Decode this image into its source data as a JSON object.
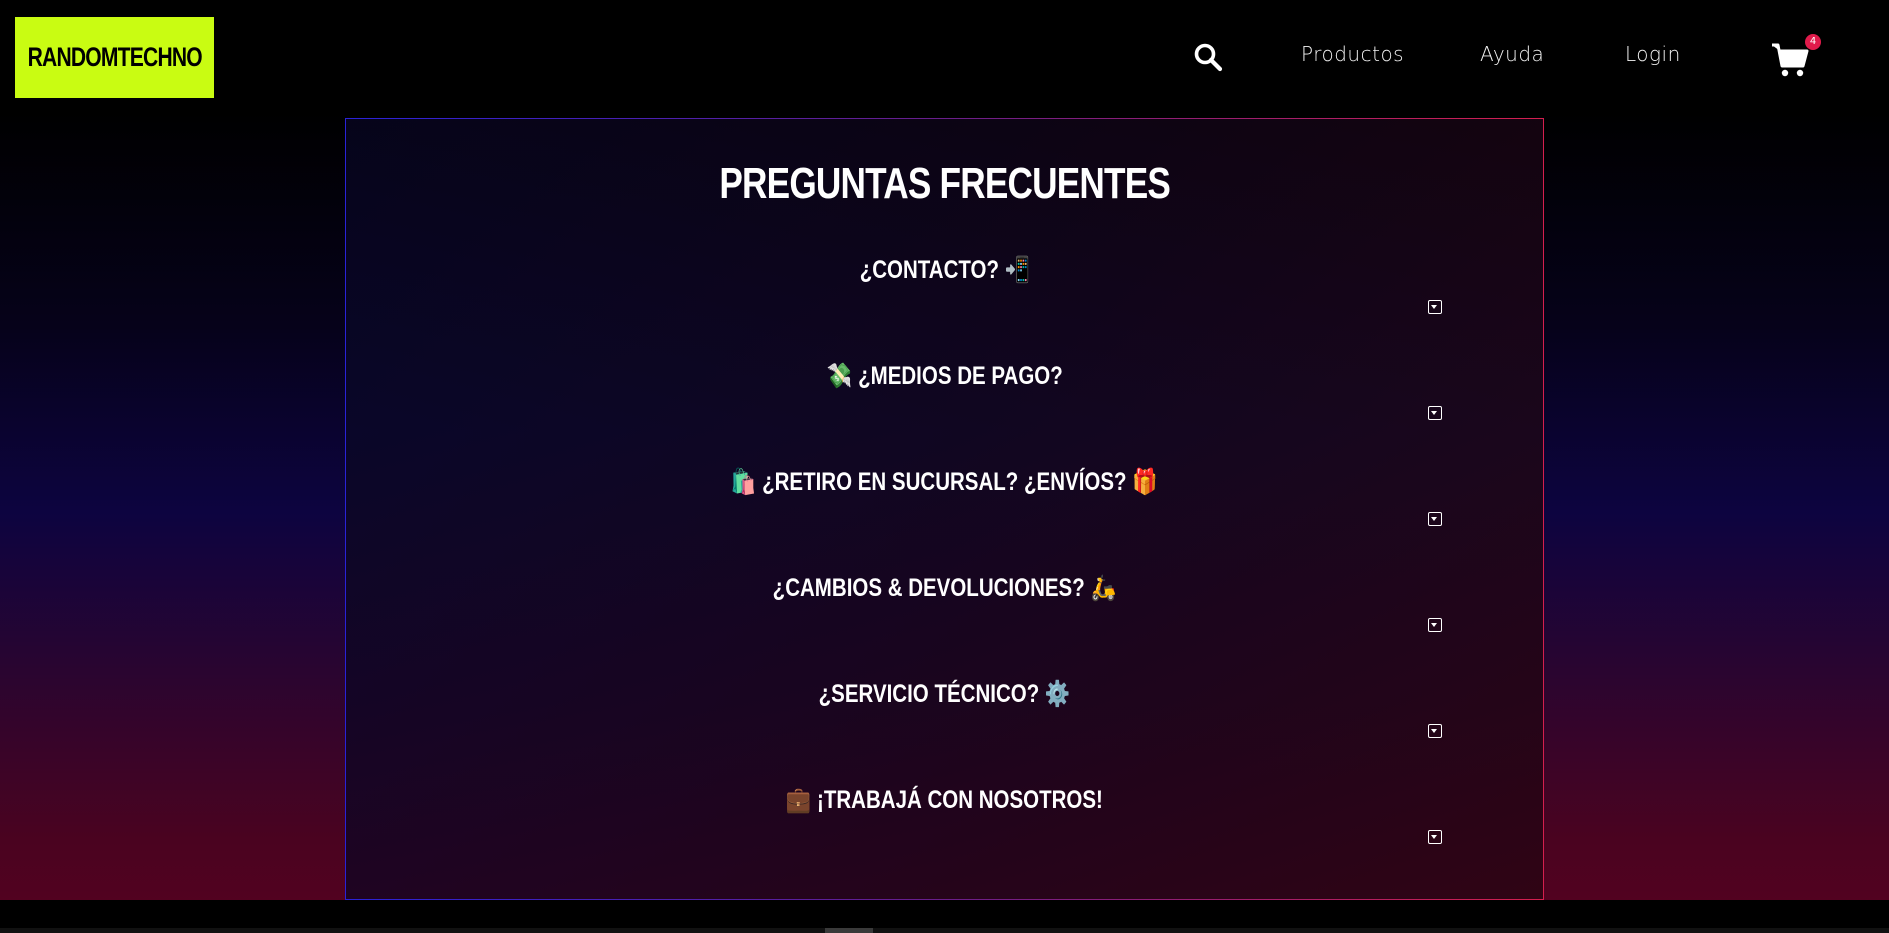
{
  "header": {
    "logo_text": "RANDOMTECHNO",
    "nav": [
      {
        "label": "Productos"
      },
      {
        "label": "Ayuda"
      },
      {
        "label": "Login"
      }
    ],
    "cart_count": "4",
    "icons": {
      "search": "search-icon",
      "cart": "cart-icon"
    }
  },
  "faq": {
    "title": "PREGUNTAS FRECUENTES",
    "items": [
      {
        "question": "¿CONTACTO? 📲"
      },
      {
        "question": "💸 ¿MEDIOS DE PAGO?"
      },
      {
        "question": "🛍️ ¿RETIRO EN SUCURSAL? ¿ENVÍOS? 🎁"
      },
      {
        "question": "¿CAMBIOS & DEVOLUCIONES? 🛵"
      },
      {
        "question": "¿SERVICIO TÉCNICO? ⚙️"
      },
      {
        "question": "💼 ¡TRABAJÁ CON NOSOTROS!"
      }
    ]
  },
  "colors": {
    "logo_bg": "#c9fc12",
    "badge": "#e01b4b",
    "border_left": "#2a22d8",
    "border_right": "#d41f4e"
  }
}
